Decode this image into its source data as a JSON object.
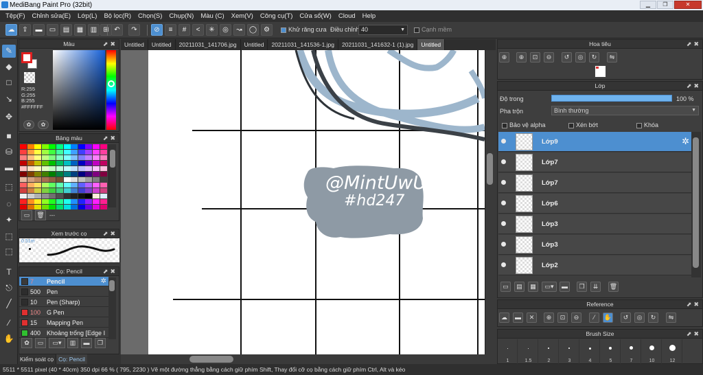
{
  "window": {
    "title": "MediBang Paint Pro (32bit)"
  },
  "menu": [
    "Tệp(F)",
    "Chỉnh sửa(E)",
    "Lớp(L)",
    "Bộ lọc(R)",
    "Chọn(S)",
    "Chụp(N)",
    "Màu (C)",
    "Xem(V)",
    "Công cụ(T)",
    "Cửa sổ(W)",
    "Cloud",
    "Help"
  ],
  "toolbar": {
    "antialias_label": "Khử răng cưa",
    "correction_label": "Điều chỉnh",
    "correction_value": "40",
    "edge_label": "Cạnh mềm"
  },
  "color_panel": {
    "title": "Màu",
    "rgb_r": "R:255",
    "rgb_g": "G:255",
    "rgb_b": "B:255",
    "hex": "#FFFFFF"
  },
  "palette_panel": {
    "title": "Bảng màu",
    "footer_text": "---",
    "colors": [
      "#ff0000",
      "#ff8000",
      "#ffff00",
      "#80ff00",
      "#00ff00",
      "#00ff80",
      "#00ffff",
      "#0080ff",
      "#0000ff",
      "#8000ff",
      "#ff00ff",
      "#ff0080",
      "#ff4040",
      "#ffa040",
      "#ffff40",
      "#a0ff40",
      "#40ff40",
      "#40ffa0",
      "#40ffff",
      "#40a0ff",
      "#4040ff",
      "#a040ff",
      "#ff40ff",
      "#ff40a0",
      "#ff8080",
      "#ffc080",
      "#ffff80",
      "#c0ff80",
      "#80ff80",
      "#80ffc0",
      "#80ffff",
      "#80c0ff",
      "#8080ff",
      "#c080ff",
      "#ff80ff",
      "#ff80c0",
      "#c00000",
      "#c06000",
      "#c0c000",
      "#60c000",
      "#00c000",
      "#00c060",
      "#00c0c0",
      "#0060c0",
      "#0000c0",
      "#6000c0",
      "#c000c0",
      "#c00060",
      "#ffc0c0",
      "#ffe0c0",
      "#ffffc0",
      "#e0ffc0",
      "#c0ffc0",
      "#c0ffe0",
      "#c0ffff",
      "#c0e0ff",
      "#c0c0ff",
      "#e0c0ff",
      "#ffc0ff",
      "#ffc0e0",
      "#800000",
      "#804000",
      "#808000",
      "#408000",
      "#008000",
      "#008040",
      "#008080",
      "#004080",
      "#000080",
      "#400080",
      "#800080",
      "#800040",
      "#e6b8a0",
      "#d4a080",
      "#c08860",
      "#a87050",
      "#906040",
      "#785030",
      "#ffffff",
      "#e0e0e0",
      "#c0c0c0",
      "#a0a0a0",
      "#808080",
      "#404040",
      "#ff6060",
      "#ffb060",
      "#ffe060",
      "#b0ff60",
      "#60ff60",
      "#60ffb0",
      "#60ffff",
      "#60b0ff",
      "#6060ff",
      "#b060ff",
      "#ff60ff",
      "#ff60b0",
      "#d04040",
      "#d08040",
      "#d0d040",
      "#80d040",
      "#40d040",
      "#40d080",
      "#40d0d0",
      "#4080d0",
      "#4040d0",
      "#8040d0",
      "#d040d0",
      "#d04080",
      "#f0f0f0",
      "#d0d0d0",
      "#b0b0b0",
      "#909090",
      "#707070",
      "#505050",
      "#303030",
      "#202020",
      "#101010",
      "#000000",
      "#ffeedd",
      "#ddeeff",
      "#ff2020",
      "#ff9020",
      "#ffee20",
      "#90ff20",
      "#20ff20",
      "#20ff90",
      "#20ffee",
      "#2090ff",
      "#2020ff",
      "#9020ff",
      "#ff20ff",
      "#ff2090",
      "#e00000",
      "#e07000",
      "#e0e000",
      "#70e000",
      "#00e000",
      "#00e070",
      "#00e0e0",
      "#0070e0",
      "#0000e0",
      "#7000e0",
      "#e000e0",
      "#e00070"
    ]
  },
  "preview_panel": {
    "title": "Xem trước cọ",
    "size": "0.51m"
  },
  "brush_panel": {
    "title": "Cọ: Pencil",
    "items": [
      {
        "size": "7",
        "name": "Pencil",
        "color": "#3a3a3a"
      },
      {
        "size": "500",
        "name": "Pen",
        "color": "#2d2d2d"
      },
      {
        "size": "10",
        "name": "Pen (Sharp)",
        "color": "#2d2d2d"
      },
      {
        "size": "100",
        "name": "G Pen",
        "color": "#e03030"
      },
      {
        "size": "15",
        "name": "Mapping Pen",
        "color": "#e03030"
      },
      {
        "size": "400",
        "name": "Khoảng trống [Edge I",
        "color": "#30c030"
      }
    ]
  },
  "left_tabs": [
    "Kiểm soát cọ",
    "Cọ: Pencil"
  ],
  "doc_tabs": [
    "Untitled",
    "Untitled",
    "20211031_141706.jpg",
    "Untitled",
    "20211031_141536-1.jpg",
    "20211031_141632-1 (1).jpg",
    "Untitled"
  ],
  "canvas": {
    "line1": "@MintUwU",
    "line2": "#hd247"
  },
  "navigator": {
    "title": "Hoa tiêu"
  },
  "layer_panel": {
    "title": "Lớp",
    "opacity_label": "Độ trong",
    "opacity_value": "100 %",
    "blend_label": "Pha trộn",
    "blend_value": "Bình thường",
    "protect_alpha": "Bảo vệ alpha",
    "clipping": "Xén bớt",
    "lock": "Khóa",
    "layers": [
      "Lớp9",
      "Lớp7",
      "Lớp7",
      "Lớp6",
      "Lớp3",
      "Lớp3",
      "Lớp2"
    ]
  },
  "reference_panel": {
    "title": "Reference"
  },
  "brush_size_panel": {
    "title": "Brush Size",
    "sizes": [
      "1",
      "1.5",
      "2",
      "3",
      "4",
      "5",
      "7",
      "10",
      "12"
    ]
  },
  "status": {
    "size": "5511 * 5511 pixel",
    "physical": "(40 * 40cm)",
    "dpi": "350 dpi",
    "zoom": "66 %",
    "coords": "( 795, 2230 )",
    "hint": "Vẽ một đường thẳng bằng cách giữ phím Shift, Thay đổi cỡ cọ bằng cách giữ phím Ctrl, Alt và kéo"
  },
  "colors": {
    "accent": "#4d8fd0",
    "panel": "#3e3e3e",
    "primary_color_border": "#e02020"
  }
}
